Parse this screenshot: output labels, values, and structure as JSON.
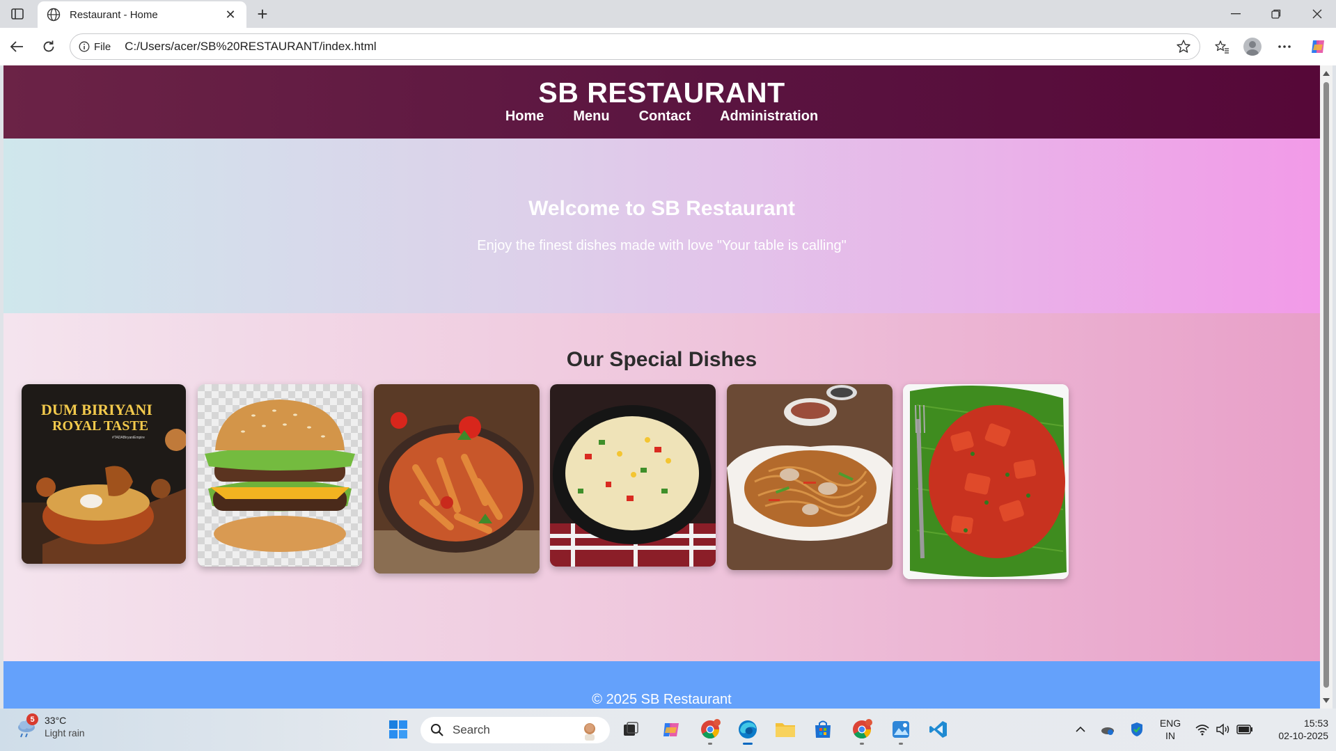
{
  "browser": {
    "tab_title": "Restaurant - Home",
    "address_label": "File",
    "url": "C:/Users/acer/SB%20RESTAURANT/index.html"
  },
  "site": {
    "brand": "SB RESTAURANT",
    "nav": [
      "Home",
      "Menu",
      "Contact",
      "Administration"
    ],
    "hero_title": "Welcome to SB Restaurant",
    "hero_subtitle": "Enjoy the finest dishes made with love \"Your table is calling\"",
    "dishes_title": "Our Special Dishes",
    "biryani_poster_line1": "DUM BIRIYANI",
    "biryani_poster_line2": "ROYAL TASTE",
    "biryani_poster_tag": "#TADABiryaniEmpire",
    "footer": "© 2025 SB Restaurant"
  },
  "taskbar": {
    "weather_badge": "5",
    "temperature": "33°C",
    "condition": "Light rain",
    "search_placeholder": "Search",
    "lang_line1": "ENG",
    "lang_line2": "IN",
    "time": "15:53",
    "date": "02-10-2025"
  }
}
